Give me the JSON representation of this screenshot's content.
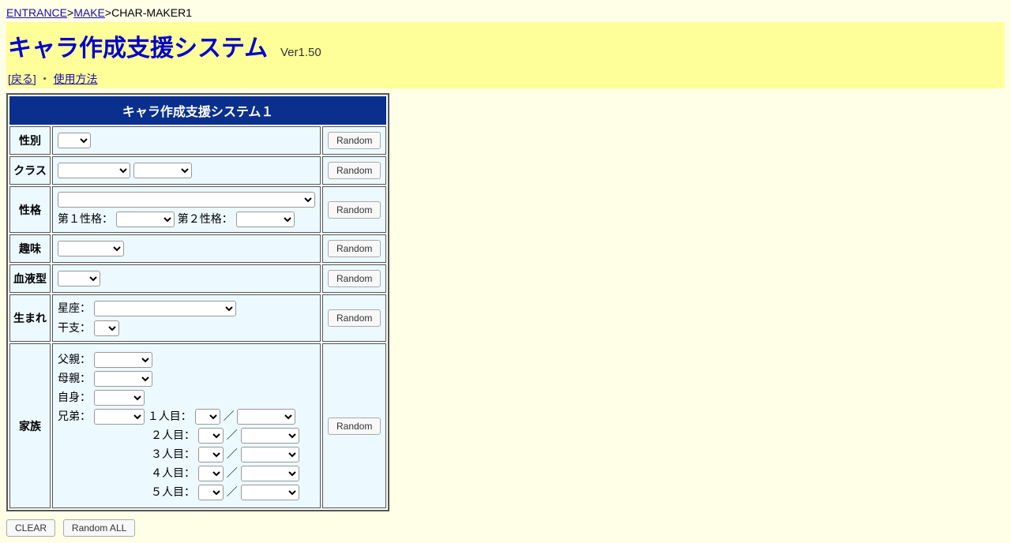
{
  "breadcrumb": {
    "entrance": "ENTRANCE",
    "make": "MAKE",
    "current": "CHAR-MAKER1"
  },
  "title": "キャラ作成支援システム",
  "version": "Ver1.50",
  "subnav": {
    "back": "[戻る]",
    "bullet": "・",
    "usage": "使用方法"
  },
  "table": {
    "header": "キャラ作成支援システム１",
    "rows": {
      "gender": "性別",
      "class": "クラス",
      "personality": "性格",
      "personality_sub1": "第１性格：",
      "personality_sub2": "第２性格：",
      "hobby": "趣味",
      "blood": "血液型",
      "birth": "生まれ",
      "birth_zodiac": "星座：",
      "birth_eto": "干支：",
      "family": "家族",
      "family_father": "父親：",
      "family_mother": "母親：",
      "family_self": "自身：",
      "family_siblings": "兄弟：",
      "sib1": "１人目：",
      "sib2": "２人目：",
      "sib3": "３人目：",
      "sib4": "４人目：",
      "sib5": "５人目：",
      "slash": "／"
    },
    "random_label": "Random"
  },
  "footer": {
    "clear": "CLEAR",
    "random_all": "Random ALL"
  }
}
